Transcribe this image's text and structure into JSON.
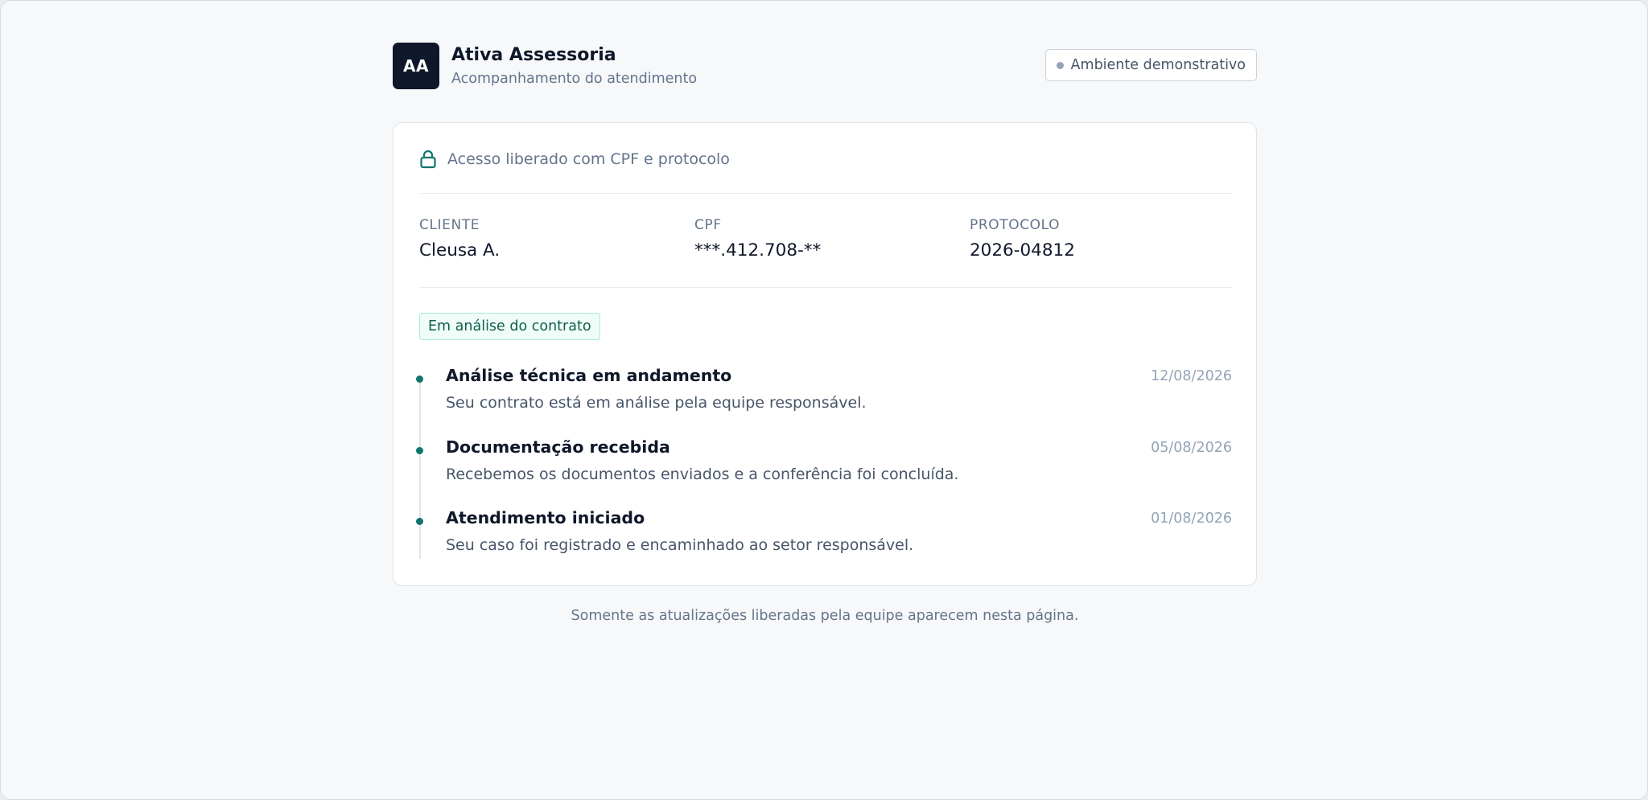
{
  "header": {
    "logo_initials": "AA",
    "brand_name": "Ativa Assessoria",
    "brand_subtitle": "Acompanhamento do atendimento",
    "env_badge": "Ambiente demonstrativo"
  },
  "card": {
    "access_text": "Acesso liberado com CPF e protocolo",
    "info": [
      {
        "label": "CLIENTE",
        "value": "Cleusa A."
      },
      {
        "label": "CPF",
        "value": "***.412.708-**"
      },
      {
        "label": "PROTOCOLO",
        "value": "2026-04812"
      }
    ],
    "status": "Em análise do contrato",
    "timeline": [
      {
        "title": "Análise técnica em andamento",
        "description": "Seu contrato está em análise pela equipe responsável.",
        "date": "12/08/2026"
      },
      {
        "title": "Documentação recebida",
        "description": "Recebemos os documentos enviados e a conferência foi concluída.",
        "date": "05/08/2026"
      },
      {
        "title": "Atendimento iniciado",
        "description": "Seu caso foi registrado e encaminhado ao setor responsável.",
        "date": "01/08/2026"
      }
    ]
  },
  "footnote": "Somente as atualizações liberadas pela equipe aparecem nesta página.",
  "colors": {
    "accent": "#0f766e",
    "logo_bg": "#0f172a",
    "status_bg": "#effcf7",
    "status_border": "#a7ecd8"
  },
  "icons": {
    "access": "lock-icon",
    "env": "status-dot-icon"
  }
}
